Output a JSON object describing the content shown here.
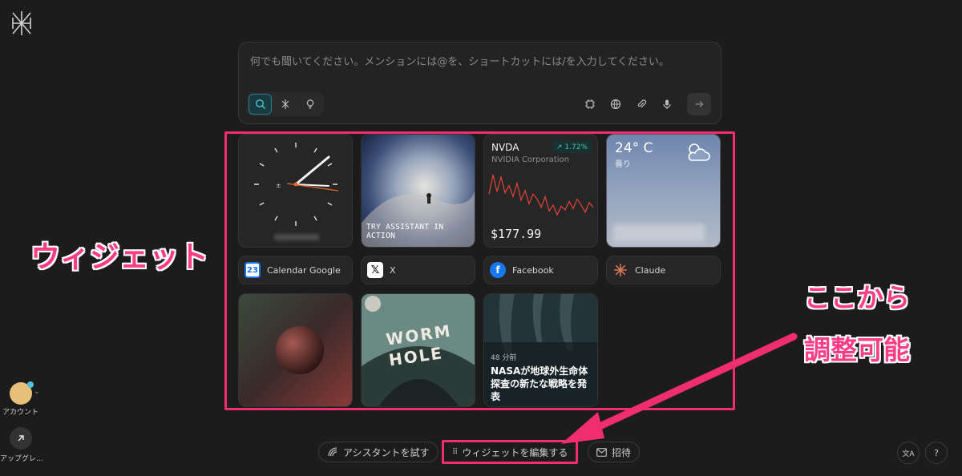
{
  "prompt": {
    "placeholder": "何でも聞いてください。メンションには@を、ショートカットには/を入力してください。"
  },
  "widgets": {
    "assistant_caption": "TRY ASSISTANT IN ACTION",
    "stock": {
      "ticker": "NVDA",
      "company": "NVIDIA Corporation",
      "change": "1.72%",
      "price": "$177.99",
      "trend": [
        62,
        30,
        58,
        34,
        60,
        48,
        66,
        44,
        72,
        56,
        78,
        62,
        70,
        84,
        66,
        90,
        80,
        96,
        82,
        88,
        74,
        86,
        70,
        80,
        92,
        76,
        84
      ]
    },
    "weather": {
      "temp": "24° C",
      "condition": "曇り"
    },
    "links": [
      {
        "label": "Calendar Google",
        "icon": "calendar-icon"
      },
      {
        "label": "X",
        "icon": "x-logo-icon"
      },
      {
        "label": "Facebook",
        "icon": "facebook-icon"
      },
      {
        "label": "Claude",
        "icon": "claude-icon"
      }
    ],
    "wormhole_title_line1": "WORM",
    "wormhole_title_line2": "HOLE",
    "news": {
      "time": "48 分前",
      "headline": "NASAが地球外生命体探査の新たな戦略を発表"
    }
  },
  "annotations": {
    "widget_label": "ウィジェット",
    "adjust_line1": "ここから",
    "adjust_line2": "調整可能"
  },
  "sidebar": {
    "account_label": "アカウント",
    "upgrade_label": "アップグレ..."
  },
  "bottom": {
    "try_assistant": "アシスタントを試す",
    "edit_widgets": "ウィジェットを編集する",
    "invite": "招待",
    "help": "?"
  },
  "colors": {
    "accent": "#ef2d6f",
    "teal": "#2b7e88",
    "stock_line": "#e0443a"
  }
}
